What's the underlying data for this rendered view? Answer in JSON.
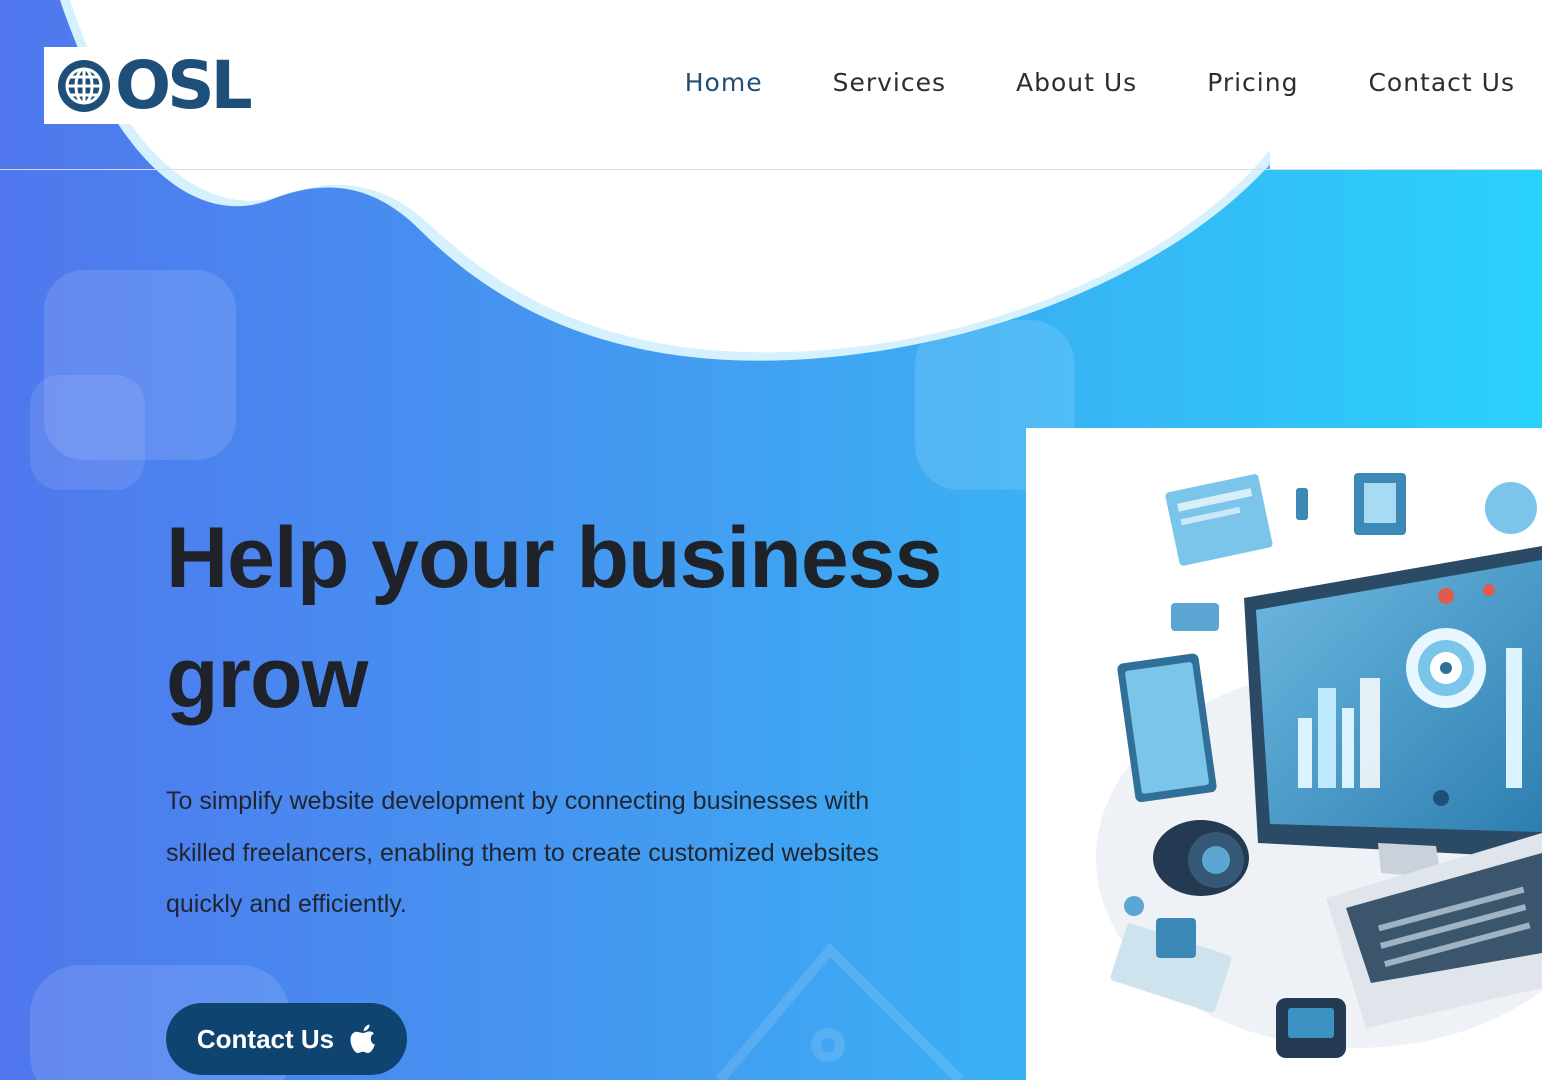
{
  "brand": {
    "logo_text": "OSL",
    "primary_color": "#1d4f79"
  },
  "nav": {
    "items": [
      {
        "label": "Home",
        "active": true
      },
      {
        "label": "Services",
        "active": false
      },
      {
        "label": "About Us",
        "active": false
      },
      {
        "label": "Pricing",
        "active": false
      },
      {
        "label": "Contact Us",
        "active": false
      }
    ]
  },
  "hero": {
    "title": "Help your business grow",
    "description": "To simplify website development by connecting businesses with skilled freelancers, enabling them to create customized websites quickly and efficiently.",
    "cta_label": "Contact Us",
    "cta_icon": "apple-icon",
    "gradient_start": "#5077ee",
    "gradient_end": "#29d2fb"
  },
  "illustration": {
    "icon": "computer-tech-illustration"
  }
}
